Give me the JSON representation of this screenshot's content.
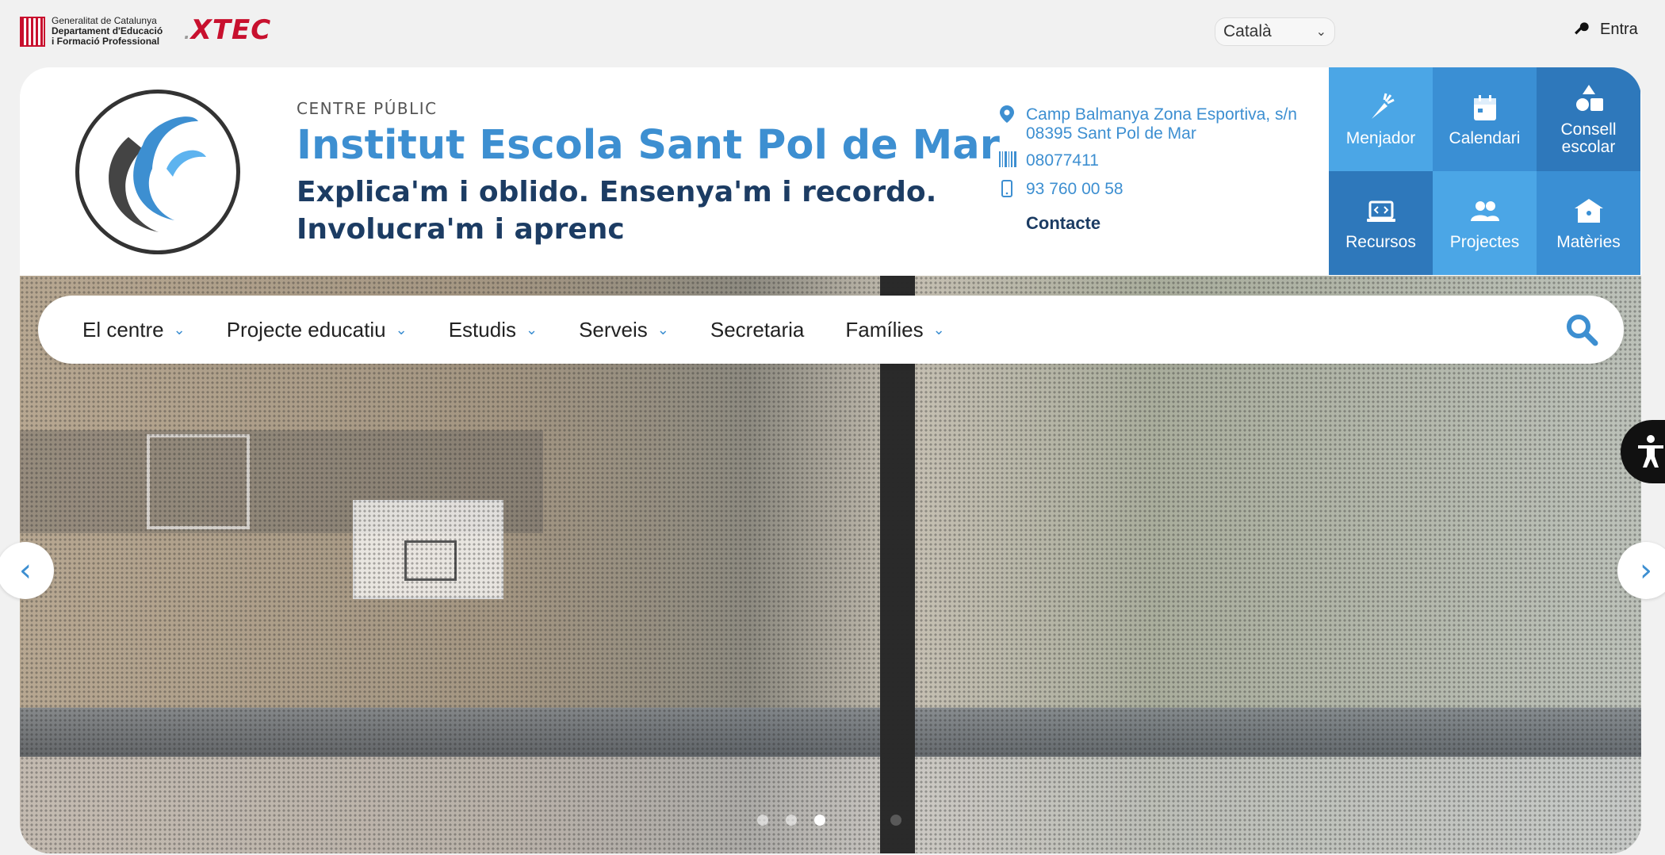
{
  "topbar": {
    "gencat_line1": "Generalitat de Catalunya",
    "gencat_line2": "Departament d'Educació",
    "gencat_line3": "i Formació Professional",
    "xtec_label": "XTEC",
    "language_selected": "Català",
    "login_label": "Entra"
  },
  "header": {
    "kicker": "CENTRE PÚBLIC",
    "school_name": "Institut Escola Sant Pol de Mar",
    "motto_line1": "Explica'm i oblido. Ensenya'm i recordo.",
    "motto_line2": "Involucra'm i aprenc"
  },
  "contact": {
    "address_line1": "Camp Balmanya Zona Esportiva, s/n",
    "address_line2": "08395 Sant Pol de Mar",
    "code": "08077411",
    "phone": "93 760 00 58",
    "contact_link": "Contacte"
  },
  "tiles": [
    {
      "label": "Menjador",
      "icon": "carrot-icon",
      "color": "#4ba6e6"
    },
    {
      "label": "Calendari",
      "icon": "calendar-icon",
      "color": "#3a8fd4"
    },
    {
      "label": "Consell escolar",
      "icon": "shapes-icon",
      "color": "#2e78bb"
    },
    {
      "label": "Recursos",
      "icon": "laptop-code-icon",
      "color": "#2e78bb"
    },
    {
      "label": "Projectes",
      "icon": "users-icon",
      "color": "#4ba6e6"
    },
    {
      "label": "Matèries",
      "icon": "school-icon",
      "color": "#3a8fd4"
    }
  ],
  "nav": {
    "items": [
      {
        "label": "El centre",
        "has_dropdown": true
      },
      {
        "label": "Projecte educatiu",
        "has_dropdown": true
      },
      {
        "label": "Estudis",
        "has_dropdown": true
      },
      {
        "label": "Serveis",
        "has_dropdown": true
      },
      {
        "label": "Secretaria",
        "has_dropdown": false
      },
      {
        "label": "Famílies",
        "has_dropdown": true
      }
    ],
    "search_icon": "search-icon"
  },
  "slider": {
    "dot_count": 4,
    "active_dot": 3,
    "prev_icon": "chevron-left-icon",
    "next_icon": "chevron-right-icon"
  },
  "colors": {
    "accent": "#3d8fd1",
    "dark_blue": "#1c3c63",
    "xtec_red": "#c8102e"
  }
}
